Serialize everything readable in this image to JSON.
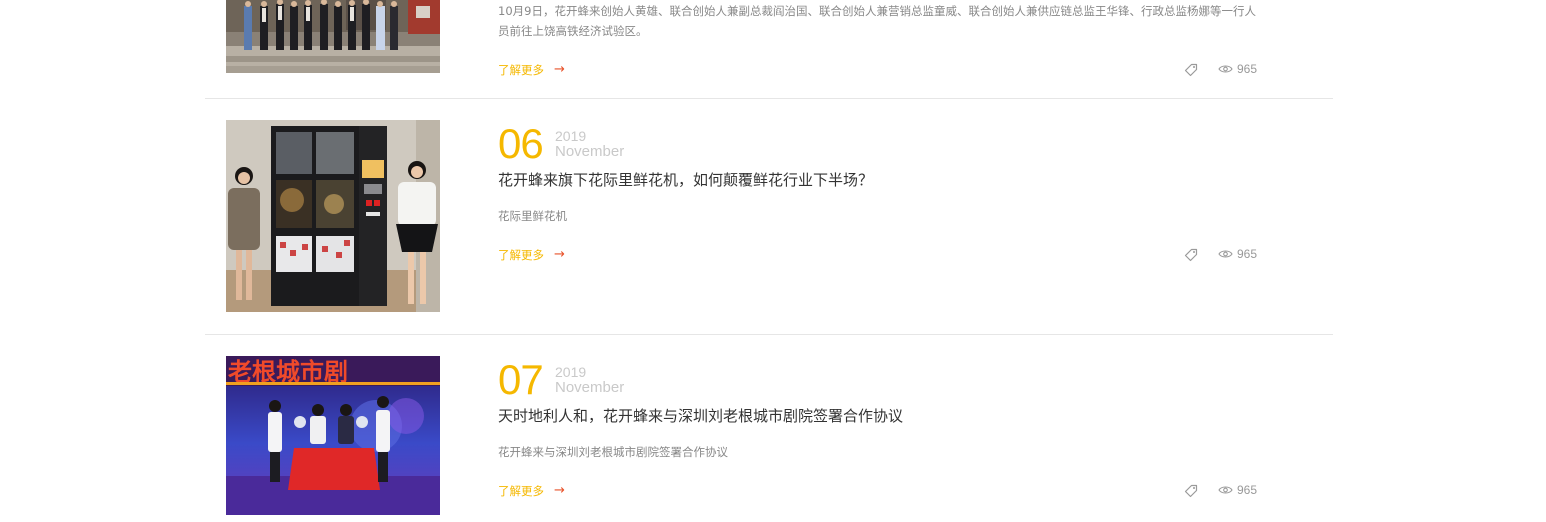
{
  "articles": [
    {
      "desc": "10月9日，花开蜂来创始人黄雄、联合创始人兼副总裁阎治国、联合创始人兼营销总监童威、联合创始人兼供应链总监王华锋、行政总监杨娜等一行人员前往上饶高铁经济试验区。",
      "more_label": "了解更多",
      "arrow": "→",
      "views": "965"
    },
    {
      "day": "06",
      "year": "2019",
      "month": "November",
      "title": "花开蜂来旗下花际里鲜花机，如何颠覆鲜花行业下半场？",
      "desc": "花际里鲜花机",
      "more_label": "了解更多",
      "arrow": "→",
      "views": "965"
    },
    {
      "day": "07",
      "year": "2019",
      "month": "November",
      "title": "天时地利人和，花开蜂来与深圳刘老根城市剧院签署合作协议",
      "desc": "花开蜂来与深圳刘老根城市剧院签署合作协议",
      "banner_text": "老根城市剧",
      "more_label": "了解更多",
      "arrow": "→",
      "views": "965"
    }
  ],
  "colors": {
    "accent": "#f5b800",
    "arrow": "#e8532b",
    "muted": "#c9c9c9"
  }
}
